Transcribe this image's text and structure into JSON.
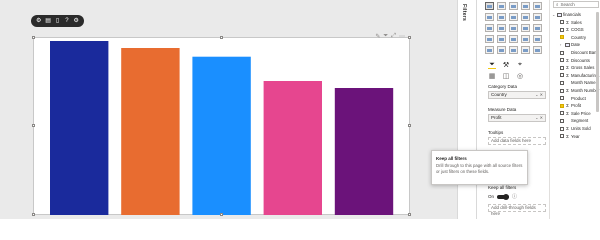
{
  "floating_toolbar": {
    "buttons": [
      {
        "name": "visual-settings-icon",
        "glyph": "⚙"
      },
      {
        "name": "comments-icon",
        "glyph": "▤"
      },
      {
        "name": "page-icon",
        "glyph": "▯"
      },
      {
        "name": "help-icon",
        "glyph": "?"
      },
      {
        "name": "settings-icon",
        "glyph": "⚙"
      }
    ]
  },
  "visual_header_icons": [
    "pin-icon",
    "filter-icon",
    "expand-icon",
    "more-options-icon"
  ],
  "chart_data": {
    "type": "bar",
    "categories": [
      "",
      "",
      "",
      "",
      ""
    ],
    "values": [
      100,
      96,
      91,
      77,
      73
    ],
    "colors": [
      "#1a2a9c",
      "#e86c30",
      "#1a8fff",
      "#e6468f",
      "#6b137a"
    ],
    "ylim": [
      0,
      100
    ],
    "title": "",
    "xlabel": "",
    "ylabel": ""
  },
  "filters_pane": {
    "label": "Filters"
  },
  "viz_pane": {
    "category_label": "Category Data",
    "category_value": "Country",
    "measure_label": "Measure Data",
    "measure_value": "Profit",
    "tooltips_label": "Tooltips",
    "add_data_fields": "Add data fields here",
    "keep_all_filters_label": "Keep all filters",
    "toggle_label": "On",
    "add_drillthrough": "Add drill-through fields here"
  },
  "tooltip": {
    "title": "Keep all filters",
    "body": "Drill through to this page with all source filters or just filters on these fields."
  },
  "fields_pane": {
    "search_placeholder": "Search",
    "items": [
      {
        "label": "financials",
        "type": "table",
        "checked": false,
        "expanded": true,
        "indent": 0
      },
      {
        "label": "Sales",
        "type": "sigma",
        "checked": false,
        "indent": 1
      },
      {
        "label": "COGS",
        "type": "sigma",
        "checked": false,
        "indent": 1
      },
      {
        "label": "Country",
        "type": "field",
        "checked": true,
        "indent": 1
      },
      {
        "label": "Date",
        "type": "table",
        "checked": false,
        "expanded": false,
        "indent": 1
      },
      {
        "label": "Discount Band",
        "type": "field",
        "checked": false,
        "indent": 1
      },
      {
        "label": "Discounts",
        "type": "sigma",
        "checked": false,
        "indent": 1
      },
      {
        "label": "Gross Sales",
        "type": "sigma",
        "checked": false,
        "indent": 1
      },
      {
        "label": "Manufacturing...",
        "type": "sigma",
        "checked": false,
        "indent": 1
      },
      {
        "label": "Month Name",
        "type": "field",
        "checked": false,
        "indent": 1
      },
      {
        "label": "Month Number",
        "type": "sigma",
        "checked": false,
        "indent": 1
      },
      {
        "label": "Product",
        "type": "field",
        "checked": false,
        "indent": 1
      },
      {
        "label": "Profit",
        "type": "sigma",
        "checked": true,
        "indent": 1
      },
      {
        "label": "Sale Price",
        "type": "sigma",
        "checked": false,
        "indent": 1
      },
      {
        "label": "Segment",
        "type": "field",
        "checked": false,
        "indent": 1
      },
      {
        "label": "Units Sold",
        "type": "sigma",
        "checked": false,
        "indent": 1
      },
      {
        "label": "Year",
        "type": "sigma",
        "checked": false,
        "indent": 1
      }
    ]
  }
}
